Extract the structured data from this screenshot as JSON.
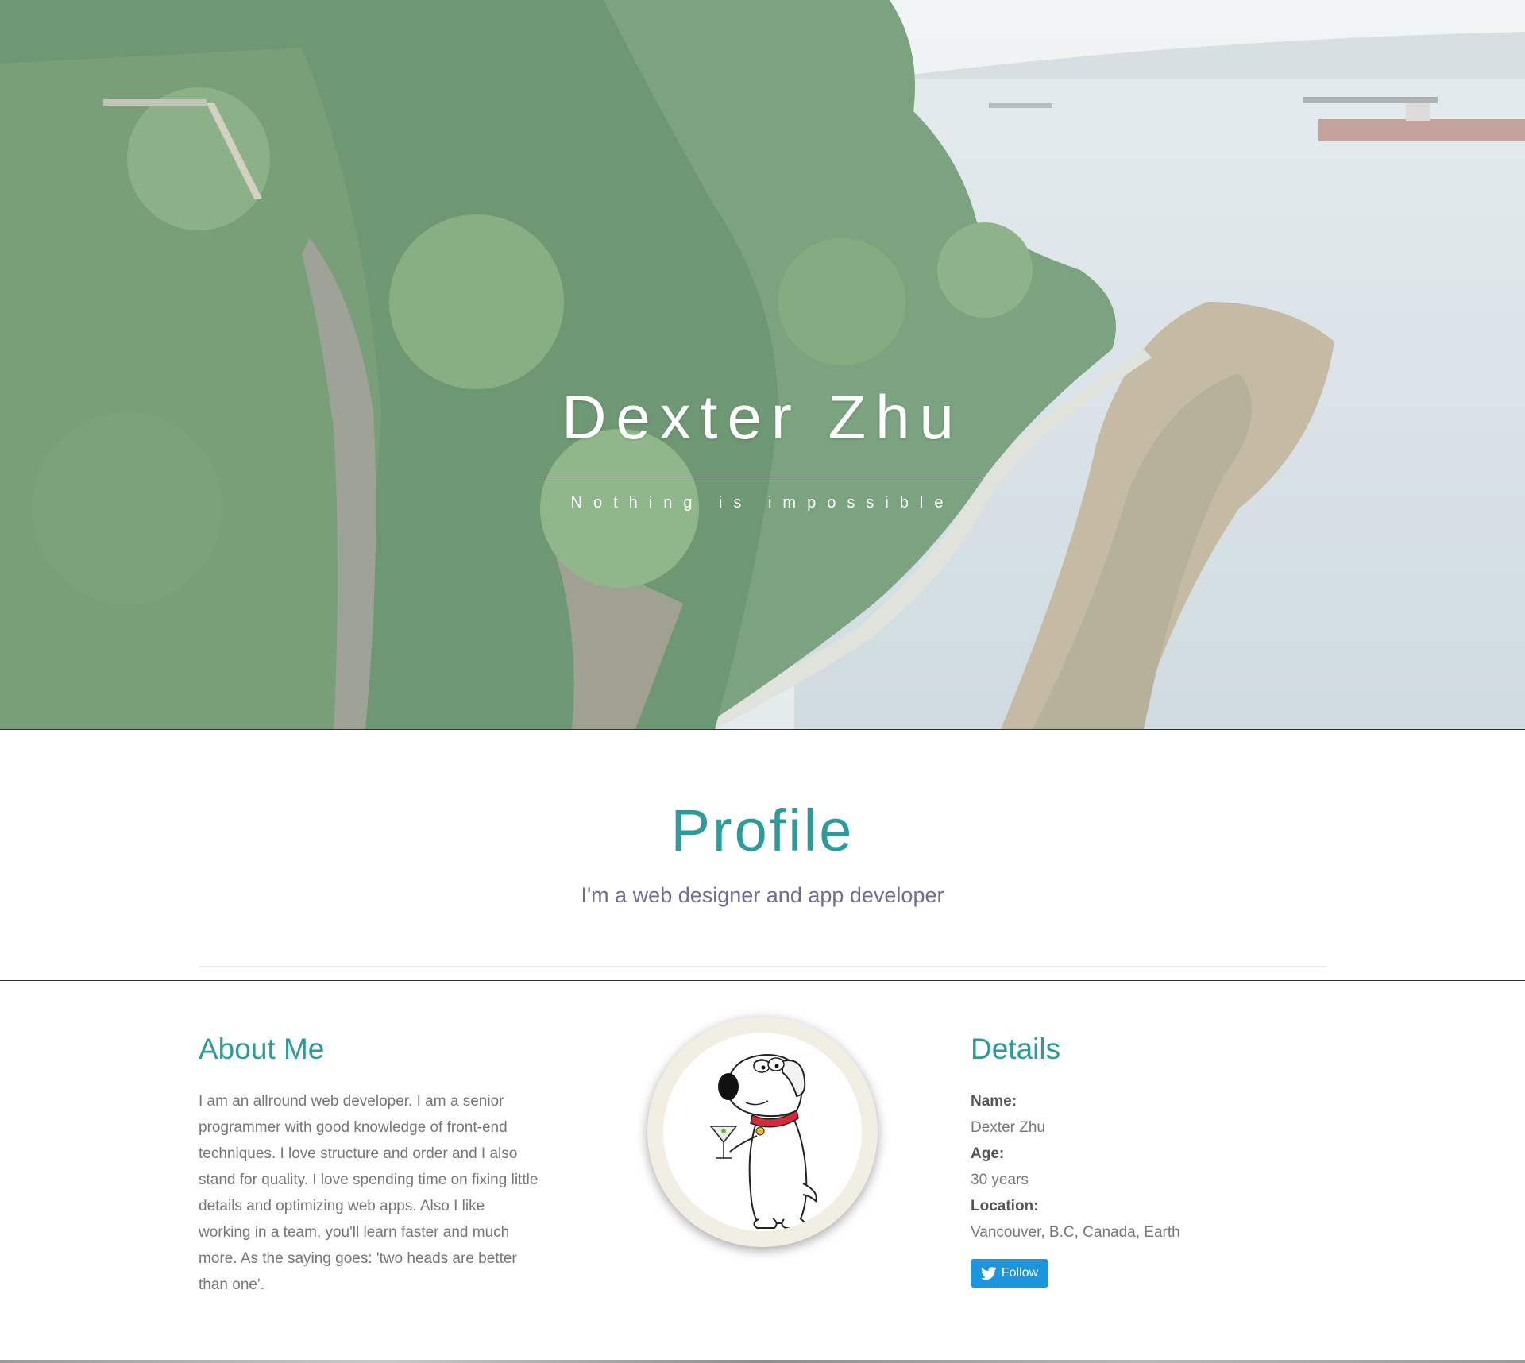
{
  "hero": {
    "title": "Dexter Zhu",
    "tagline": "Nothing is impossible"
  },
  "profile": {
    "title": "Profile",
    "subtitle": "I'm a web designer and app developer"
  },
  "about": {
    "heading": "About Me",
    "text": "I am an allround web developer. I am a senior programmer with good knowledge of front-end techniques. I love structure and order and I also stand for quality. I love spending time on fixing little details and optimizing web apps. Also I like working in a team, you'll learn faster and much more. As the saying goes: 'two heads are better than one'."
  },
  "details": {
    "heading": "Details",
    "name_label": "Name:",
    "name_value": "Dexter Zhu",
    "age_label": "Age:",
    "age_value": "30 years",
    "location_label": "Location:",
    "location_value": "Vancouver, B.C, Canada, Earth",
    "follow_label": "Follow"
  },
  "icons": {
    "twitter": "twitter-bird-icon",
    "avatar": "cartoon-dog-avatar"
  },
  "colors": {
    "accent": "#2a9d9a",
    "subtitle": "#6c6f94",
    "twitter": "#1b95e0"
  }
}
